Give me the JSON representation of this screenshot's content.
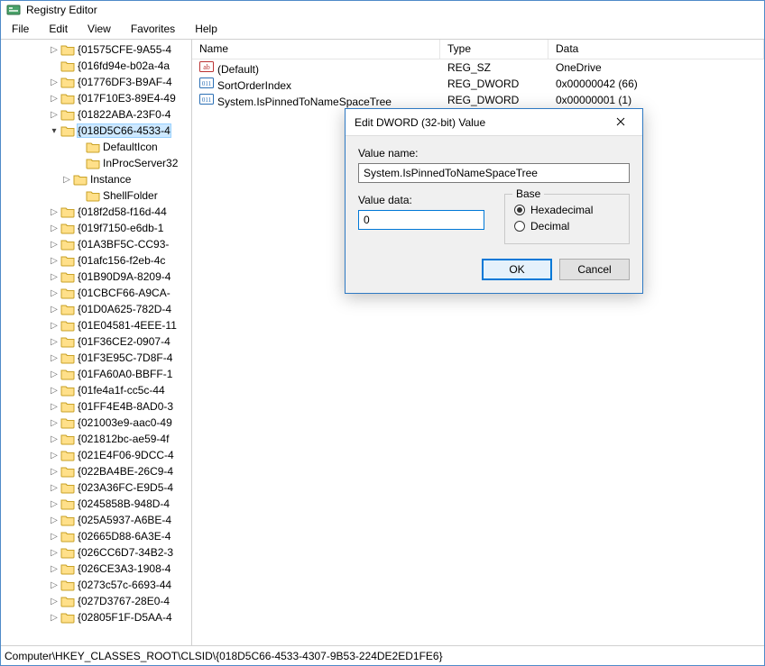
{
  "window": {
    "title": "Registry Editor"
  },
  "menubar": {
    "file": "File",
    "edit": "Edit",
    "view": "View",
    "favorites": "Favorites",
    "help": "Help"
  },
  "tree": {
    "nodes": [
      {
        "level": "a",
        "expander": "closed",
        "label": "{01575CFE-9A55-4"
      },
      {
        "level": "a",
        "expander": "none",
        "label": "{016fd94e-b02a-4a"
      },
      {
        "level": "a",
        "expander": "closed",
        "label": "{01776DF3-B9AF-4"
      },
      {
        "level": "a",
        "expander": "closed",
        "label": "{017F10E3-89E4-49"
      },
      {
        "level": "a",
        "expander": "closed",
        "label": "{01822ABA-23F0-4"
      },
      {
        "level": "a",
        "expander": "open",
        "label": "{018D5C66-4533-4",
        "selected": true
      },
      {
        "level": "c",
        "expander": "none",
        "label": "DefaultIcon"
      },
      {
        "level": "c",
        "expander": "none",
        "label": "InProcServer32"
      },
      {
        "level": "b",
        "expander": "closed",
        "label": "Instance"
      },
      {
        "level": "c",
        "expander": "none",
        "label": "ShellFolder"
      },
      {
        "level": "a",
        "expander": "closed",
        "label": "{018f2d58-f16d-44"
      },
      {
        "level": "a",
        "expander": "closed",
        "label": "{019f7150-e6db-1"
      },
      {
        "level": "a",
        "expander": "closed",
        "label": "{01A3BF5C-CC93-"
      },
      {
        "level": "a",
        "expander": "closed",
        "label": "{01afc156-f2eb-4c"
      },
      {
        "level": "a",
        "expander": "closed",
        "label": "{01B90D9A-8209-4"
      },
      {
        "level": "a",
        "expander": "closed",
        "label": "{01CBCF66-A9CA-"
      },
      {
        "level": "a",
        "expander": "closed",
        "label": "{01D0A625-782D-4"
      },
      {
        "level": "a",
        "expander": "closed",
        "label": "{01E04581-4EEE-11"
      },
      {
        "level": "a",
        "expander": "closed",
        "label": "{01F36CE2-0907-4"
      },
      {
        "level": "a",
        "expander": "closed",
        "label": "{01F3E95C-7D8F-4"
      },
      {
        "level": "a",
        "expander": "closed",
        "label": "{01FA60A0-BBFF-1"
      },
      {
        "level": "a",
        "expander": "closed",
        "label": "{01fe4a1f-cc5c-44"
      },
      {
        "level": "a",
        "expander": "closed",
        "label": "{01FF4E4B-8AD0-3"
      },
      {
        "level": "a",
        "expander": "closed",
        "label": "{021003e9-aac0-49"
      },
      {
        "level": "a",
        "expander": "closed",
        "label": "{021812bc-ae59-4f"
      },
      {
        "level": "a",
        "expander": "closed",
        "label": "{021E4F06-9DCC-4"
      },
      {
        "level": "a",
        "expander": "closed",
        "label": "{022BA4BE-26C9-4"
      },
      {
        "level": "a",
        "expander": "closed",
        "label": "{023A36FC-E9D5-4"
      },
      {
        "level": "a",
        "expander": "closed",
        "label": "{0245858B-948D-4"
      },
      {
        "level": "a",
        "expander": "closed",
        "label": "{025A5937-A6BE-4"
      },
      {
        "level": "a",
        "expander": "closed",
        "label": "{02665D88-6A3E-4"
      },
      {
        "level": "a",
        "expander": "closed",
        "label": "{026CC6D7-34B2-3"
      },
      {
        "level": "a",
        "expander": "closed",
        "label": "{026CE3A3-1908-4"
      },
      {
        "level": "a",
        "expander": "closed",
        "label": "{0273c57c-6693-44"
      },
      {
        "level": "a",
        "expander": "closed",
        "label": "{027D3767-28E0-4"
      },
      {
        "level": "a",
        "expander": "closed",
        "label": "{02805F1F-D5AA-4"
      }
    ]
  },
  "list": {
    "headers": {
      "name": "Name",
      "type": "Type",
      "data": "Data"
    },
    "rows": [
      {
        "icon": "str",
        "name": "(Default)",
        "type": "REG_SZ",
        "data": "OneDrive"
      },
      {
        "icon": "bin",
        "name": "SortOrderIndex",
        "type": "REG_DWORD",
        "data": "0x00000042 (66)"
      },
      {
        "icon": "bin",
        "name": "System.IsPinnedToNameSpaceTree",
        "type": "REG_DWORD",
        "data": "0x00000001 (1)"
      }
    ]
  },
  "dialog": {
    "title": "Edit DWORD (32-bit) Value",
    "labels": {
      "value_name": "Value name:",
      "value_data": "Value data:",
      "base": "Base",
      "hex": "Hexadecimal",
      "dec": "Decimal",
      "ok": "OK",
      "cancel": "Cancel"
    },
    "value_name": "System.IsPinnedToNameSpaceTree",
    "value_data": "0",
    "base_selected": "hex"
  },
  "statusbar": {
    "path": "Computer\\HKEY_CLASSES_ROOT\\CLSID\\{018D5C66-4533-4307-9B53-224DE2ED1FE6}"
  }
}
